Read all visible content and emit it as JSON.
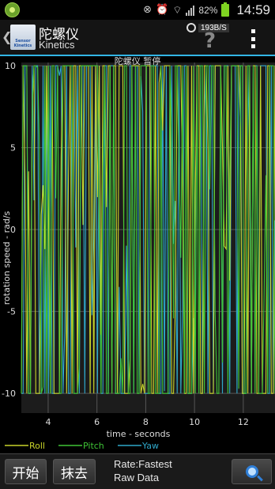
{
  "status_bar": {
    "battery_pct": "82%",
    "time": "14:59",
    "icons": [
      "app-notification-icon",
      "mute-icon",
      "alarm-icon",
      "wifi-icon",
      "signal-icon",
      "battery-icon"
    ]
  },
  "header": {
    "app_icon_caption": "Sensor\nKinetics",
    "title": "陀螺仪",
    "subtitle": "Kinetics",
    "rate_chip": "193B/S",
    "help_label": "?",
    "icons": [
      "back-chevron-icon",
      "app-icon",
      "data-rate-icon",
      "help-icon",
      "overflow-menu-icon"
    ]
  },
  "chart_data": {
    "type": "line",
    "title": "陀螺仪 暂停",
    "xlabel": "time - seconds",
    "ylabel": "rotation speed - rad/s",
    "xlim": [
      2.9,
      13.3
    ],
    "ylim": [
      -11.2,
      10.2
    ],
    "x_ticks": [
      4,
      6,
      8,
      10,
      12
    ],
    "y_ticks": [
      10,
      5,
      0,
      -5,
      -10
    ],
    "grid": true,
    "legend_placement": "bottom-left",
    "colors": {
      "Roll": "#c8d42a",
      "Pitch": "#3fc436",
      "Yaw": "#2fa7c9",
      "background": "#000000",
      "plot_background": "#1c1c1c",
      "grid": "#555555"
    },
    "series": [
      {
        "name": "Roll",
        "pattern": "spiky",
        "range": [
          -10,
          10
        ]
      },
      {
        "name": "Pitch",
        "pattern": "spiky",
        "range": [
          -10,
          10
        ]
      },
      {
        "name": "Yaw",
        "pattern": "spiky",
        "range": [
          -10,
          10
        ]
      }
    ]
  },
  "bottom_bar": {
    "start_label": "开始",
    "clear_label": "抹去",
    "rate_line1": "Rate:Fastest",
    "rate_line2": "Raw Data",
    "icons": [
      "zoom-icon"
    ]
  }
}
